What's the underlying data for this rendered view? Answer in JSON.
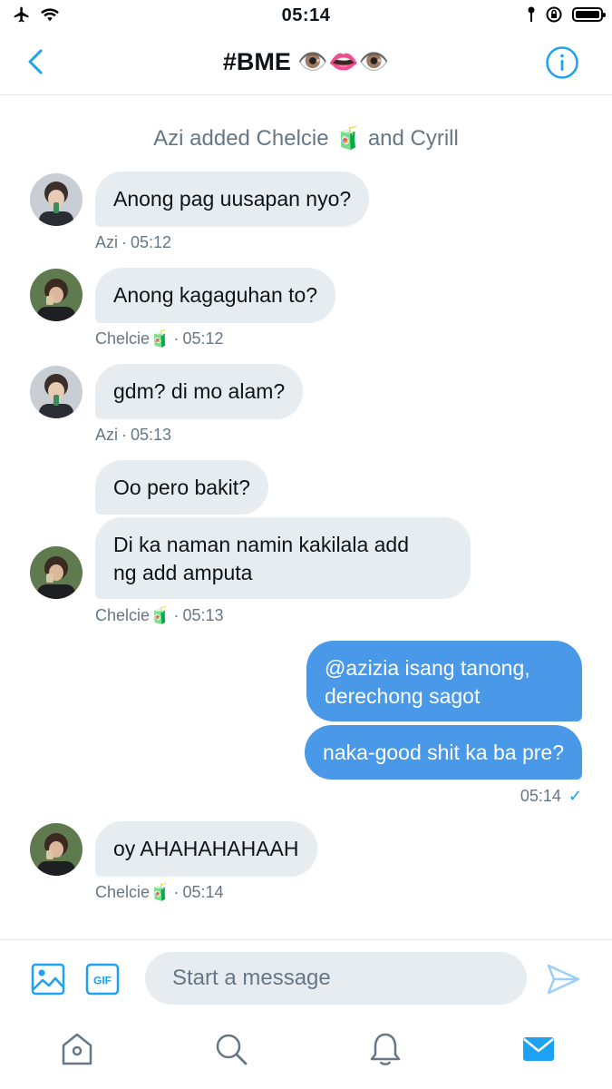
{
  "status_bar": {
    "time": "05:14"
  },
  "header": {
    "title": "#BME 👁️👄👁️"
  },
  "system_message": "Azi added Chelcie 🧃 and Cyrill",
  "messages": [
    {
      "text": "Anong pag uusapan nyo?",
      "sender": "Azi",
      "time": "05:12"
    },
    {
      "text": "Anong kagaguhan to?",
      "sender": "Chelcie🧃",
      "time": "05:12"
    },
    {
      "text": "gdm? di mo alam?",
      "sender": "Azi",
      "time": "05:13"
    },
    {
      "text": "Oo pero bakit?"
    },
    {
      "text_line1": "Di ka naman namin kakilala add",
      "text_line2": "ng add amputa",
      "sender": "Chelcie🧃",
      "time": "05:13"
    },
    {
      "text_line1": "@azizia isang tanong,",
      "text_line2": "derechong sagot"
    },
    {
      "text": "naka-good shit ka ba pre?",
      "time": "05:14",
      "status": "✓"
    },
    {
      "text": "oy AHAHAHAHAAH",
      "sender": "Chelcie🧃",
      "time": "05:14"
    }
  ],
  "meta_separator": "·",
  "composer": {
    "placeholder": "Start a message"
  },
  "icons": {
    "back": "chevron-left-icon",
    "info": "info-icon",
    "image": "image-icon",
    "gif": "gif-icon",
    "send": "send-icon",
    "home": "home-icon",
    "search": "search-icon",
    "notifications": "bell-icon",
    "messages": "envelope-icon"
  },
  "colors": {
    "accent": "#1da1f2",
    "bubble_out": "#4a99e9",
    "bubble_in": "#e6ecf0",
    "secondary_text": "#657786"
  }
}
